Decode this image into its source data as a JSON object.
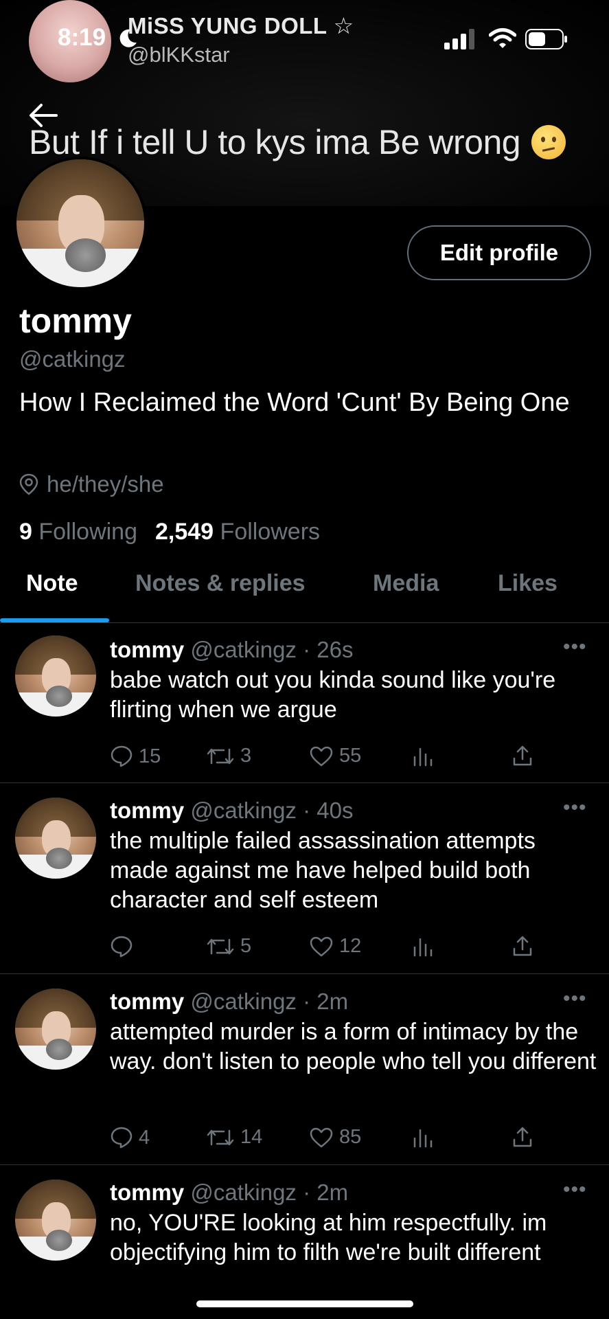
{
  "status_bar": {
    "time": "8:19"
  },
  "banner": {
    "name": "MiSS YUNG DOLL ☆",
    "handle": "@blKKstar",
    "text": "But If i tell U to kys ima Be wrong"
  },
  "profile": {
    "edit_label": "Edit profile",
    "display_name": "tommy",
    "handle": "@catkingz",
    "bio": "How I Reclaimed the Word 'Cunt' By Being One",
    "location": "he/they/she",
    "following_count": "9",
    "following_label": "Following",
    "followers_count": "2,549",
    "followers_label": "Followers"
  },
  "tabs": [
    "Note",
    "Notes & replies",
    "Media",
    "Likes"
  ],
  "tweets": [
    {
      "name": "tommy",
      "meta": "@catkingz · 26s",
      "text": "babe watch out you kinda sound like you're flirting when we argue",
      "replies": "15",
      "retweets": "3",
      "likes": "55"
    },
    {
      "name": "tommy",
      "meta": "@catkingz · 40s",
      "text": "the multiple failed assassination attempts made against me have helped build both character and self esteem",
      "replies": "",
      "retweets": "5",
      "likes": "12"
    },
    {
      "name": "tommy",
      "meta": "@catkingz · 2m",
      "text": "attempted murder is a form of intimacy by the way. don't listen to people who tell you different",
      "replies": "4",
      "retweets": "14",
      "likes": "85"
    },
    {
      "name": "tommy",
      "meta": "@catkingz · 2m",
      "text": "no, YOU'RE looking at him respectfully. im objectifying him to filth we're built different",
      "replies": "",
      "retweets": "",
      "likes": ""
    }
  ],
  "colors": {
    "accent": "#1d9bf0",
    "muted": "#6e767d",
    "divider": "#2f3336"
  }
}
